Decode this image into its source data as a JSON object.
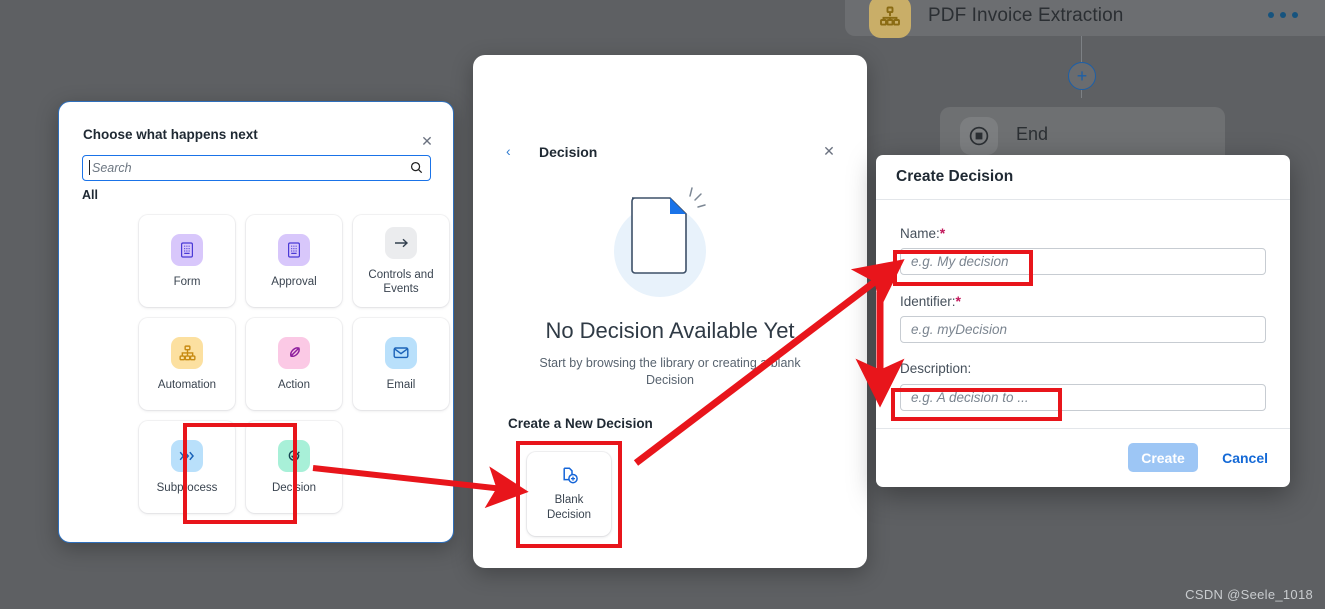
{
  "background": {
    "header_card": {
      "icon": "org-chart-icon",
      "title": "PDF Invoice Extraction",
      "menu_icon": "more-options-icon"
    },
    "add_node_icon": "plus-circle-icon",
    "end_node": {
      "icon": "end-event-icon",
      "label": "End"
    }
  },
  "left_panel": {
    "title": "Choose what happens next",
    "close_icon": "close-icon",
    "search": {
      "placeholder": "Search",
      "value": "",
      "icon": "search-icon"
    },
    "section_label": "All",
    "tiles": [
      {
        "label": "Form",
        "icon": "form-icon",
        "icon_bg": "#d8c7fb",
        "icon_color": "#4a3ad6"
      },
      {
        "label": "Approval",
        "icon": "approval-icon",
        "icon_bg": "#d8c7fb",
        "icon_color": "#4a3ad6"
      },
      {
        "label": "Controls and Events",
        "icon": "arrow-right-icon",
        "icon_bg": "#ebecee",
        "icon_color": "#33404f"
      },
      {
        "label": "Automation",
        "icon": "automation-icon",
        "icon_bg": "#fce0a0",
        "icon_color": "#c78a12"
      },
      {
        "label": "Action",
        "icon": "action-icon",
        "icon_bg": "#fbc9e5",
        "icon_color": "#8e1f9e"
      },
      {
        "label": "Email",
        "icon": "email-icon",
        "icon_bg": "#b9e0fb",
        "icon_color": "#1a62b8"
      },
      {
        "label": "Subprocess",
        "icon": "subprocess-icon",
        "icon_bg": "#b9e0fb",
        "icon_color": "#1a62b8"
      },
      {
        "label": "Decision",
        "icon": "decision-icon",
        "icon_bg": "#a8f0d8",
        "icon_color": "#13414e"
      }
    ]
  },
  "middle_panel": {
    "back_icon": "chevron-left-icon",
    "title": "Decision",
    "close_icon": "close-icon",
    "empty_icon": "blank-document-icon",
    "empty_title": "No Decision Available Yet",
    "empty_subtitle": "Start by browsing the library or creating a blank Decision",
    "create_section_label": "Create a New Decision",
    "blank_tile": {
      "icon": "add-document-icon",
      "label": "Blank Decision"
    }
  },
  "dialog": {
    "title": "Create Decision",
    "fields": [
      {
        "label": "Name:",
        "required": true,
        "placeholder": "e.g. My decision",
        "value": ""
      },
      {
        "label": "Identifier:",
        "required": true,
        "placeholder": "e.g. myDecision",
        "value": ""
      },
      {
        "label": "Description:",
        "required": false,
        "placeholder": "e.g. A decision to ...",
        "value": ""
      }
    ],
    "required_marker": "*",
    "create_label": "Create",
    "cancel_label": "Cancel",
    "create_color": "#9dc6f5",
    "cancel_color": "#1469d6"
  },
  "annotations": {
    "highlight_color": "#e8151b",
    "boxes": [
      "decision-tile",
      "blank-decision-tile",
      "name-input",
      "description-input"
    ],
    "arrows": [
      "decision-tile-to-blank-decision",
      "blank-decision-to-name-input",
      "name-input-to-description-input"
    ]
  },
  "watermark": "CSDN @Seele_1018"
}
